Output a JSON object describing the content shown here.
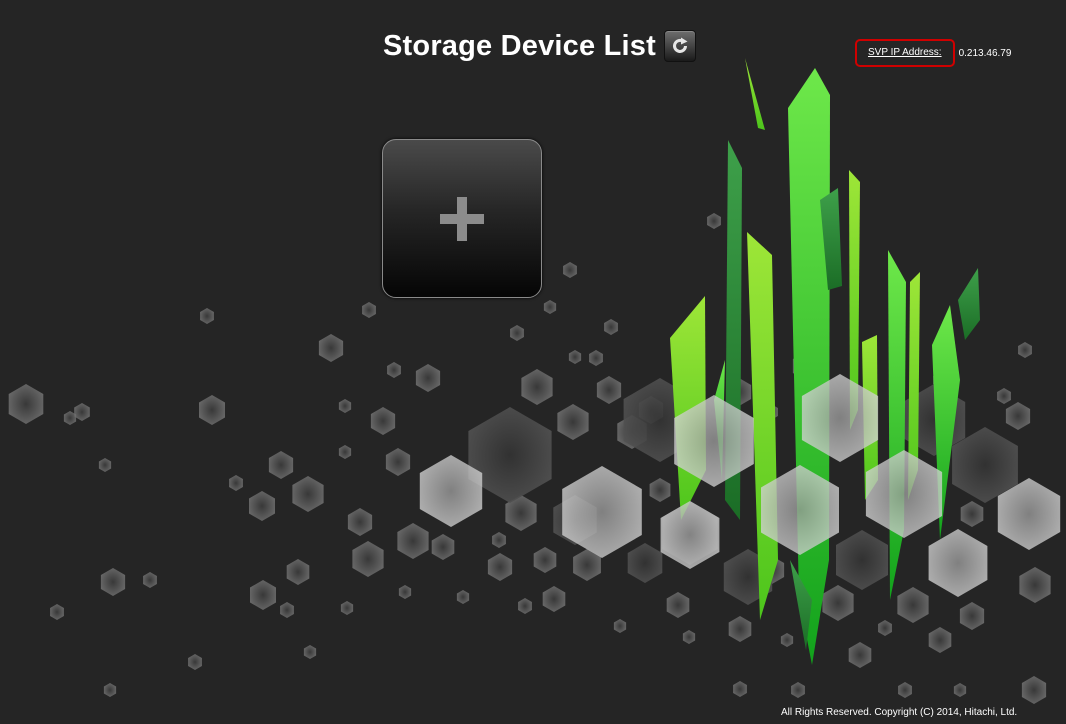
{
  "header": {
    "title": "Storage Device List",
    "refresh_icon": "refresh-icon"
  },
  "svp": {
    "link_label": "SVP IP Address:",
    "value": "0.213.46.79",
    "highlight_color": "#d00000"
  },
  "tiles": {
    "add_icon": "plus-icon"
  },
  "footer": {
    "copyright": "All Rights Reserved. Copyright (C) 2014, Hitachi, Ltd."
  },
  "theme": {
    "background": "#252525",
    "accent_green": "#2fd12f",
    "text": "#ffffff"
  }
}
